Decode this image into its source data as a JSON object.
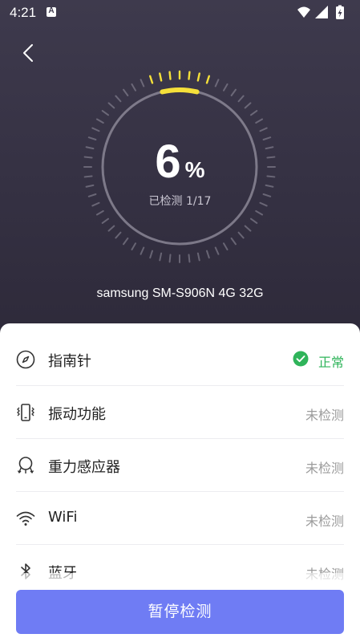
{
  "status_bar": {
    "time": "4:21",
    "notification_icon": "a-icon",
    "notification_letter": "A",
    "icons": [
      "wifi-icon",
      "signal-icon",
      "battery-icon"
    ]
  },
  "header": {
    "back_icon": "chevron-left-icon"
  },
  "gauge": {
    "percent_value": "6",
    "percent_unit": "%",
    "progress": 0.06,
    "progress_text": "已检测 1/17",
    "accent_color": "#f5e03a",
    "ring_color": "#9592a0"
  },
  "device": {
    "name": "samsung SM-S906N 4G 32G"
  },
  "checks": [
    {
      "icon": "compass-icon",
      "label": "指南针",
      "status": "正常",
      "state": "ok"
    },
    {
      "icon": "vibration-icon",
      "label": "振动功能",
      "status": "未检测",
      "state": "pending"
    },
    {
      "icon": "gravity-sensor-icon",
      "label": "重力感应器",
      "status": "未检测",
      "state": "pending"
    },
    {
      "icon": "wifi-icon",
      "label": "WiFi",
      "status": "未检测",
      "state": "pending"
    },
    {
      "icon": "bluetooth-icon",
      "label": "蓝牙",
      "status": "未检测",
      "state": "pending"
    }
  ],
  "actions": {
    "pause_label": "暂停检测",
    "button_color": "#6f7cf4"
  },
  "colors": {
    "ok": "#2fb45a",
    "pending": "#9b9b9b"
  }
}
